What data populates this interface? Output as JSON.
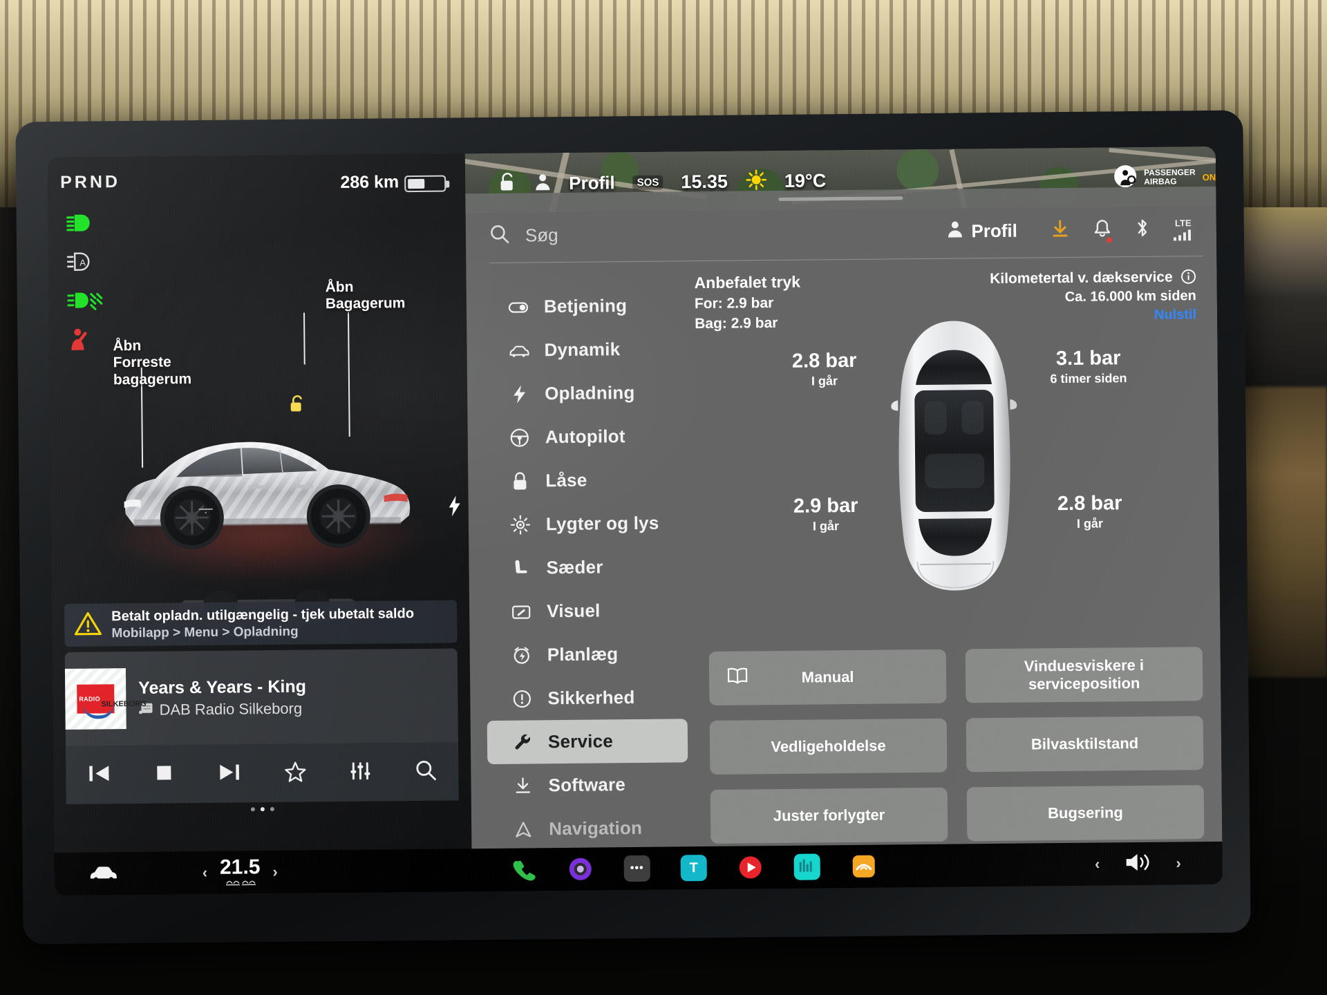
{
  "instrument": {
    "gear_indicator": "PRND",
    "range": "286 km",
    "telltales": [
      "high-beam-green",
      "auto-beam",
      "front-fog",
      "seatbelt-red"
    ],
    "callouts": [
      {
        "line1": "Åbn",
        "line2": "Forreste",
        "line3": "bagagerum"
      },
      {
        "line1": "Åbn",
        "line2": "Bagagerum",
        "line3": ""
      }
    ],
    "warning": {
      "title": "Betalt opladn. utilgængelig - tjek ubetalt saldo",
      "path": "Mobilapp > Menu > Opladning"
    },
    "media": {
      "title": "Years & Years - King",
      "source": "DAB Radio Silkeborg",
      "art_label_1": "RADIO",
      "art_label_2": "SILKEBORG",
      "controls": [
        "previous-track",
        "stop",
        "next-track",
        "favorite",
        "equalizer",
        "search"
      ]
    },
    "page_dots": 3,
    "active_dot": 2
  },
  "status_bar": {
    "profile": "Profil",
    "sos": "SOS",
    "time": "15.35",
    "temperature": "19°C",
    "airbag_line1": "PASSENGER",
    "airbag_line2": "AIRBAG",
    "airbag_state": "ON"
  },
  "settings_panel": {
    "search_placeholder": "Søg",
    "profile_label": "Profil",
    "toolbar_icons": [
      "download-icon",
      "bell-icon",
      "bluetooth-icon",
      "lte-signal-icon"
    ],
    "lte_label": "LTE",
    "menu": [
      {
        "label": "Betjening",
        "icon": "toggle-icon",
        "active": false
      },
      {
        "label": "Dynamik",
        "icon": "car-icon",
        "active": false
      },
      {
        "label": "Opladning",
        "icon": "bolt-icon",
        "active": false
      },
      {
        "label": "Autopilot",
        "icon": "steering-wheel-icon",
        "active": false
      },
      {
        "label": "Låse",
        "icon": "lock-icon",
        "active": false
      },
      {
        "label": "Lygter og lys",
        "icon": "sun-icon",
        "active": false
      },
      {
        "label": "Sæder",
        "icon": "seat-icon",
        "active": false
      },
      {
        "label": "Visuel",
        "icon": "display-icon",
        "active": false
      },
      {
        "label": "Planlæg",
        "icon": "alarm-clock-icon",
        "active": false
      },
      {
        "label": "Sikkerhed",
        "icon": "alert-circle-icon",
        "active": false
      },
      {
        "label": "Service",
        "icon": "wrench-icon",
        "active": true
      },
      {
        "label": "Software",
        "icon": "download-arrow-icon",
        "active": false
      },
      {
        "label": "Navigation",
        "icon": "navigation-icon",
        "active": false
      }
    ],
    "service": {
      "recommended_title": "Anbefalet tryk",
      "recommended_front": "For: 2.9 bar",
      "recommended_rear": "Bag: 2.9 bar",
      "odometer_title": "Kilometertal v. dækservice",
      "odometer_value": "Ca. 16.000 km siden",
      "reset_label": "Nulstil",
      "tires": [
        {
          "position": "front-left",
          "pressure": "2.8 bar",
          "when": "I går"
        },
        {
          "position": "front-right",
          "pressure": "3.1 bar",
          "when": "6 timer siden"
        },
        {
          "position": "rear-left",
          "pressure": "2.9 bar",
          "when": "I går"
        },
        {
          "position": "rear-right",
          "pressure": "2.8 bar",
          "when": "I går"
        }
      ],
      "buttons": [
        {
          "label": "Manual",
          "icon": "book-icon"
        },
        {
          "label": "Vinduesviskere i serviceposition",
          "icon": ""
        },
        {
          "label": "Vedligeholdelse",
          "icon": ""
        },
        {
          "label": "Bilvasktilstand",
          "icon": ""
        },
        {
          "label": "Juster forlygter",
          "icon": ""
        },
        {
          "label": "Bugsering",
          "icon": ""
        }
      ]
    }
  },
  "taskbar": {
    "car_icon": "car-icon",
    "temperature": "21.5",
    "left_chevron": "‹",
    "right_chevron": "›",
    "apps": [
      {
        "name": "phone-app",
        "glyph": "",
        "color": "#2fc04a"
      },
      {
        "name": "camera-app",
        "glyph": "",
        "color": "#7a2fd8"
      },
      {
        "name": "more-apps",
        "glyph": "•••",
        "color": "#3d3d3d"
      },
      {
        "name": "tidal-app",
        "glyph": "T",
        "color": "#12b7c9"
      },
      {
        "name": "youtube-app",
        "glyph": "",
        "color": "#e8232a"
      },
      {
        "name": "apple-music-app",
        "glyph": "",
        "color": "#15d6cd"
      },
      {
        "name": "audible-app",
        "glyph": "",
        "color": "#f5a623"
      }
    ],
    "volume_icon": "speaker-icon"
  },
  "colors": {
    "accent_blue": "#2f86ff",
    "warning_yellow": "#f5d000",
    "panel_grey": "#6a6c6b",
    "active_item": "#d6d8d6",
    "telltale_green": "#12e01a",
    "telltale_red": "#e02a2a"
  }
}
